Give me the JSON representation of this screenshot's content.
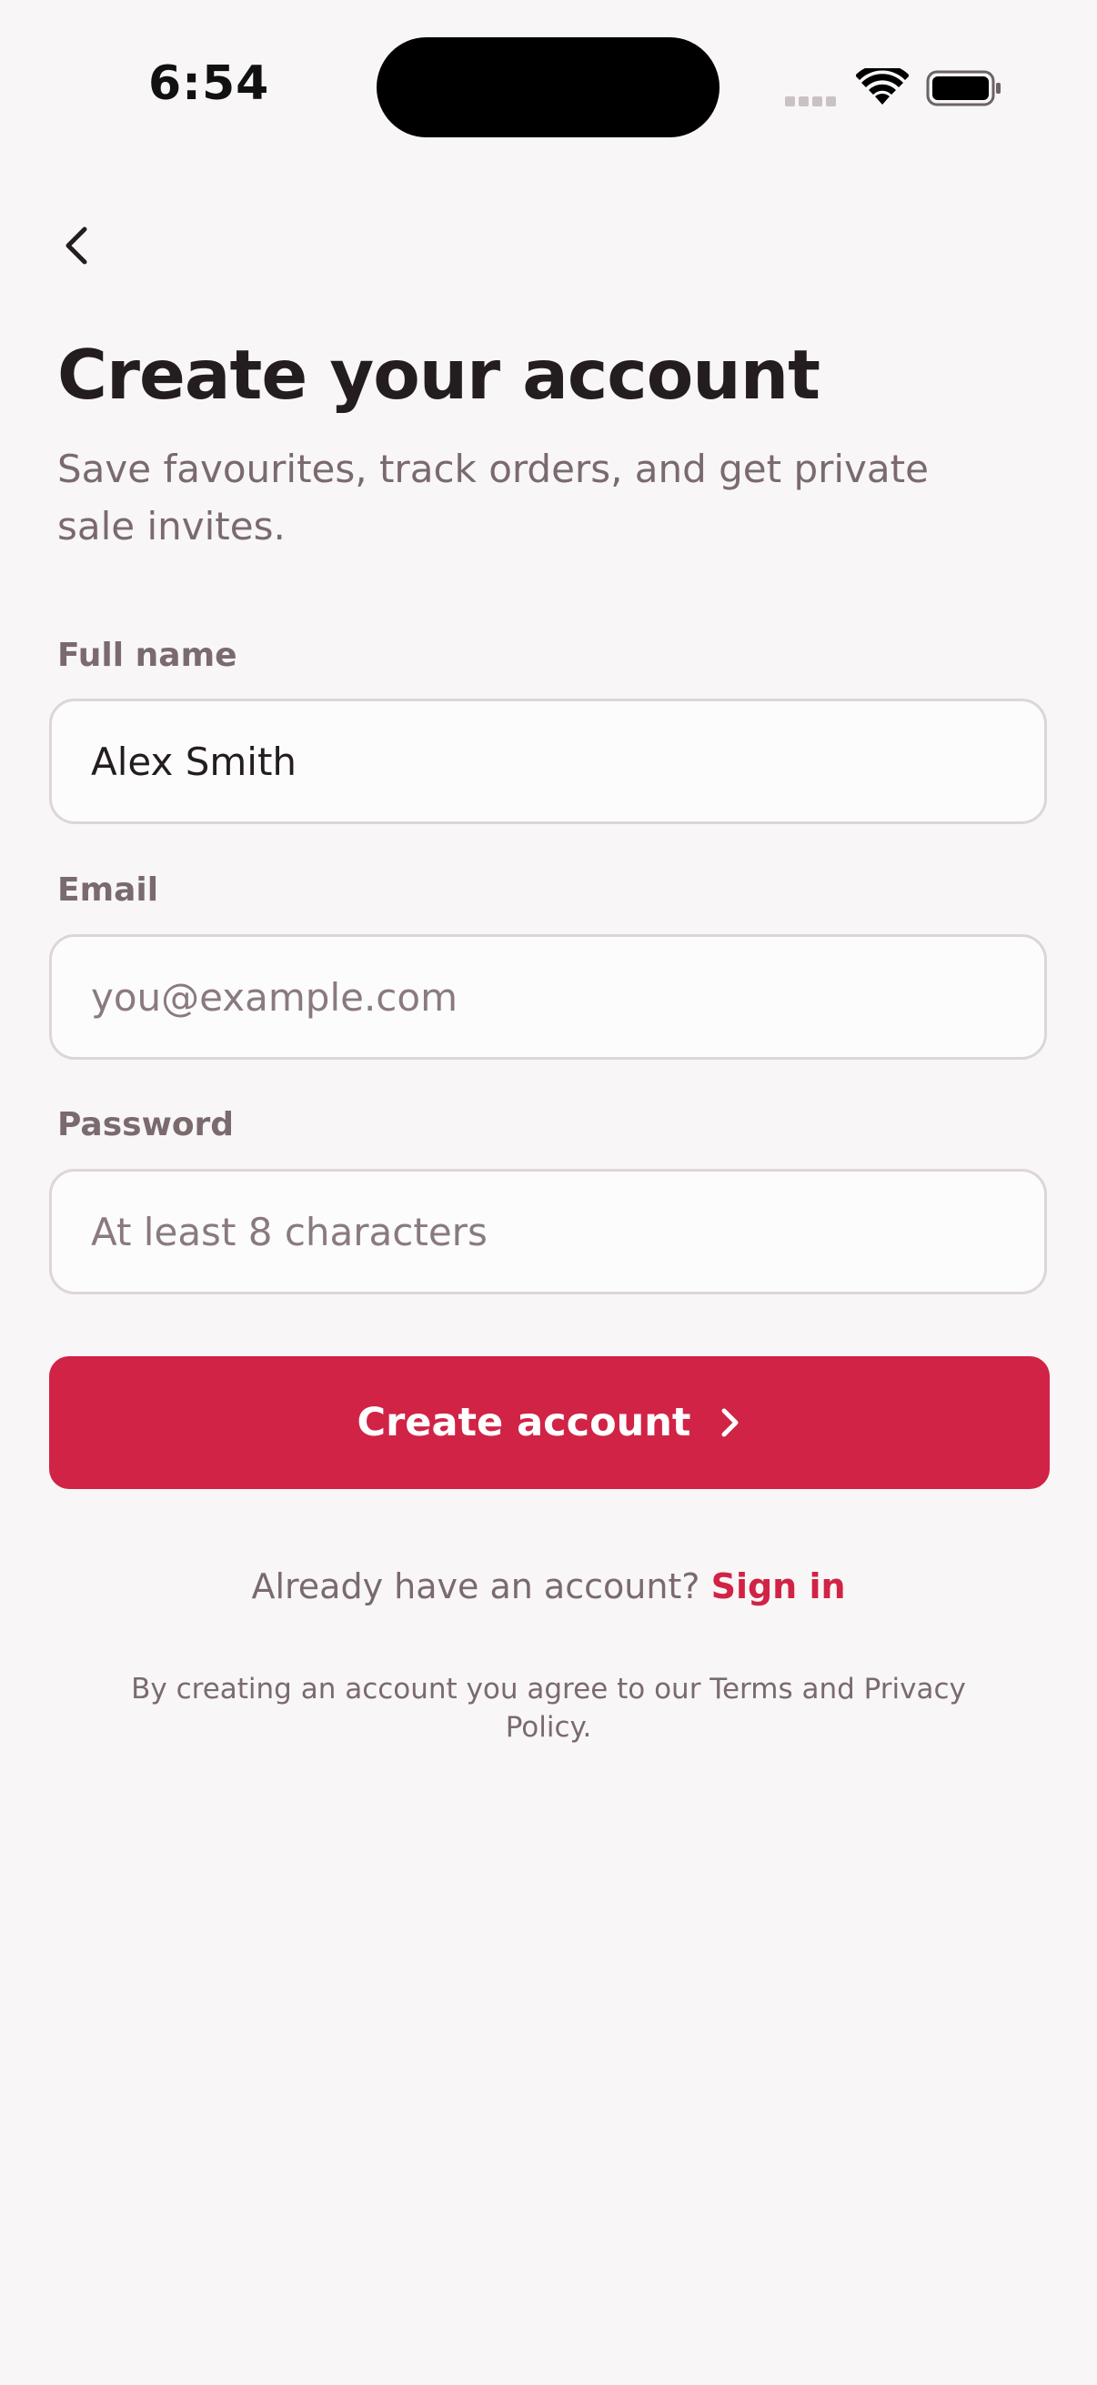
{
  "status_bar": {
    "time": "6:54"
  },
  "header": {
    "title": "Create your account",
    "subtitle": "Save favourites, track orders, and get private sale invites."
  },
  "form": {
    "full_name": {
      "label": "Full name",
      "value": "Alex Smith"
    },
    "email": {
      "label": "Email",
      "placeholder": "you@example.com",
      "value": ""
    },
    "password": {
      "label": "Password",
      "placeholder": "At least 8 characters",
      "value": ""
    },
    "submit_label": "Create account"
  },
  "footer": {
    "signin_prompt": "Already have an account?",
    "signin_link": "Sign in",
    "legal": "By creating an account you agree to our Terms and Privacy Policy."
  },
  "icons": {
    "back": "chevron-left-icon",
    "submit_arrow": "chevron-right-icon",
    "wifi": "wifi-icon",
    "battery": "battery-icon",
    "signal": "cellular-signal-icon"
  },
  "colors": {
    "accent": "#d12346",
    "background": "#f8f6f7",
    "text_primary": "#241d1f",
    "text_secondary": "#7a6a6e"
  }
}
